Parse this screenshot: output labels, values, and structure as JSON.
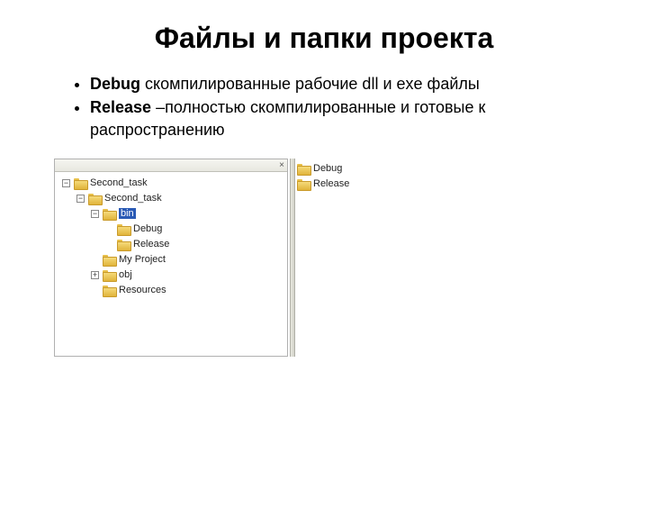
{
  "title": "Файлы и папки проекта",
  "bullets": [
    {
      "bold": "Debug",
      "rest": " скомпилированные рабочие dll и exe файлы"
    },
    {
      "bold": "Release",
      "rest": " –полностью скомпилированные и готовые к распространению"
    }
  ],
  "explorer": {
    "close": "×",
    "tree": [
      {
        "indent": 6,
        "toggle": "−",
        "label": "Second_task",
        "selected": false
      },
      {
        "indent": 22,
        "toggle": "−",
        "label": "Second_task",
        "selected": false
      },
      {
        "indent": 38,
        "toggle": "−",
        "label": "bin",
        "selected": true
      },
      {
        "indent": 54,
        "toggle": "",
        "label": "Debug",
        "selected": false
      },
      {
        "indent": 54,
        "toggle": "",
        "label": "Release",
        "selected": false
      },
      {
        "indent": 38,
        "toggle": "",
        "label": "My Project",
        "selected": false
      },
      {
        "indent": 38,
        "toggle": "+",
        "label": "obj",
        "selected": false
      },
      {
        "indent": 38,
        "toggle": "",
        "label": "Resources",
        "selected": false
      }
    ]
  },
  "right_list": [
    "Debug",
    "Release"
  ]
}
